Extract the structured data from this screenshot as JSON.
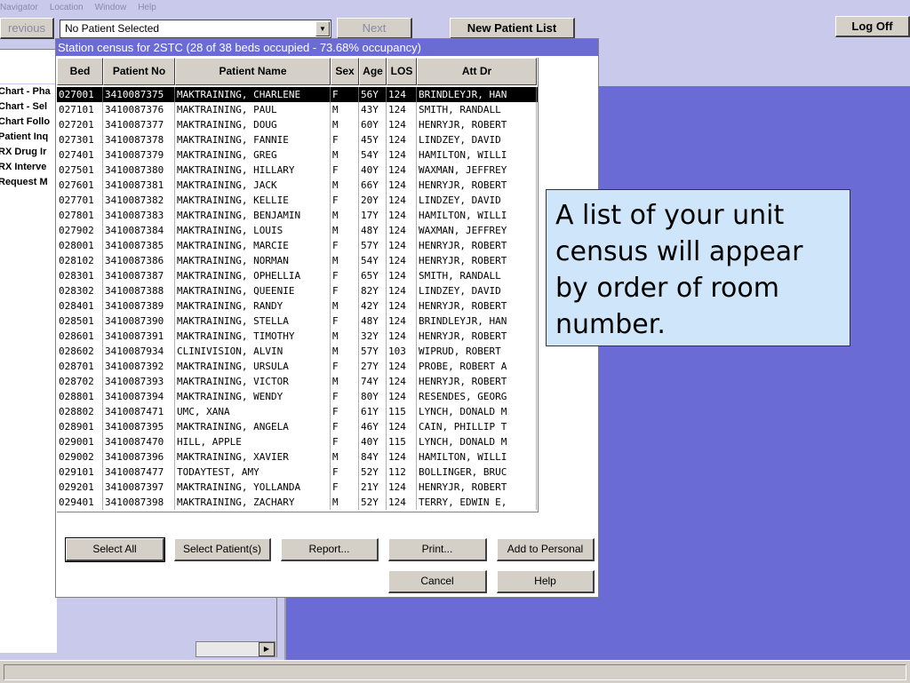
{
  "menubar": {
    "items": [
      "Navigator",
      "Location",
      "Window",
      "Help"
    ]
  },
  "toolbar": {
    "previous_label": "revious",
    "patient_select_value": "No Patient Selected",
    "next_label": "Next",
    "new_patient_list_label": "New Patient List",
    "log_off_label": "Log Off"
  },
  "left_panel": {
    "items": [
      "Chart - Pha",
      "Chart - Sel",
      "Chart Follo",
      "Patient Inq",
      "RX Drug Ir",
      "RX Interve",
      "Request M"
    ]
  },
  "dialog": {
    "title": "Station census for 2STC (28 of 38 beds occupied - 73.68% occupancy)",
    "columns": [
      "Bed",
      "Patient No",
      "Patient Name",
      "Sex",
      "Age",
      "LOS",
      "Att Dr"
    ],
    "rows": [
      [
        "027001",
        "3410087375",
        "MAKTRAINING, CHARLENE",
        "F",
        "56Y",
        "124",
        "BRINDLEYJR, HAN"
      ],
      [
        "027101",
        "3410087376",
        "MAKTRAINING, PAUL",
        "M",
        "43Y",
        "124",
        "SMITH, RANDALL"
      ],
      [
        "027201",
        "3410087377",
        "MAKTRAINING, DOUG",
        "M",
        "60Y",
        "124",
        "HENRYJR, ROBERT"
      ],
      [
        "027301",
        "3410087378",
        "MAKTRAINING, FANNIE",
        "F",
        "45Y",
        "124",
        "LINDZEY, DAVID"
      ],
      [
        "027401",
        "3410087379",
        "MAKTRAINING, GREG",
        "M",
        "54Y",
        "124",
        "HAMILTON, WILLI"
      ],
      [
        "027501",
        "3410087380",
        "MAKTRAINING, HILLARY",
        "F",
        "40Y",
        "124",
        "WAXMAN, JEFFREY"
      ],
      [
        "027601",
        "3410087381",
        "MAKTRAINING, JACK",
        "M",
        "66Y",
        "124",
        "HENRYJR, ROBERT"
      ],
      [
        "027701",
        "3410087382",
        "MAKTRAINING, KELLIE",
        "F",
        "20Y",
        "124",
        "LINDZEY, DAVID"
      ],
      [
        "027801",
        "3410087383",
        "MAKTRAINING, BENJAMIN",
        "M",
        "17Y",
        "124",
        "HAMILTON, WILLI"
      ],
      [
        "027902",
        "3410087384",
        "MAKTRAINING, LOUIS",
        "M",
        "48Y",
        "124",
        "WAXMAN, JEFFREY"
      ],
      [
        "028001",
        "3410087385",
        "MAKTRAINING, MARCIE",
        "F",
        "57Y",
        "124",
        "HENRYJR, ROBERT"
      ],
      [
        "028102",
        "3410087386",
        "MAKTRAINING, NORMAN",
        "M",
        "54Y",
        "124",
        "HENRYJR, ROBERT"
      ],
      [
        "028301",
        "3410087387",
        "MAKTRAINING, OPHELLIA",
        "F",
        "65Y",
        "124",
        "SMITH, RANDALL"
      ],
      [
        "028302",
        "3410087388",
        "MAKTRAINING, QUEENIE",
        "F",
        "82Y",
        "124",
        "LINDZEY, DAVID"
      ],
      [
        "028401",
        "3410087389",
        "MAKTRAINING, RANDY",
        "M",
        "42Y",
        "124",
        "HENRYJR, ROBERT"
      ],
      [
        "028501",
        "3410087390",
        "MAKTRAINING, STELLA",
        "F",
        "48Y",
        "124",
        "BRINDLEYJR, HAN"
      ],
      [
        "028601",
        "3410087391",
        "MAKTRAINING, TIMOTHY",
        "M",
        "32Y",
        "124",
        "HENRYJR, ROBERT"
      ],
      [
        "028602",
        "3410087934",
        "CLINIVISION, ALVIN",
        "M",
        "57Y",
        "103",
        "WIPRUD, ROBERT"
      ],
      [
        "028701",
        "3410087392",
        "MAKTRAINING, URSULA",
        "F",
        "27Y",
        "124",
        "PROBE, ROBERT A"
      ],
      [
        "028702",
        "3410087393",
        "MAKTRAINING, VICTOR",
        "M",
        "74Y",
        "124",
        "HENRYJR, ROBERT"
      ],
      [
        "028801",
        "3410087394",
        "MAKTRAINING, WENDY",
        "F",
        "80Y",
        "124",
        "RESENDES, GEORG"
      ],
      [
        "028802",
        "3410087471",
        "UMC, XANA",
        "F",
        "61Y",
        "115",
        "LYNCH, DONALD M"
      ],
      [
        "028901",
        "3410087395",
        "MAKTRAINING, ANGELA",
        "F",
        "46Y",
        "124",
        "CAIN, PHILLIP T"
      ],
      [
        "029001",
        "3410087470",
        "HILL, APPLE",
        "F",
        "40Y",
        "115",
        "LYNCH, DONALD M"
      ],
      [
        "029002",
        "3410087396",
        "MAKTRAINING, XAVIER",
        "M",
        "84Y",
        "124",
        "HAMILTON, WILLI"
      ],
      [
        "029101",
        "3410087477",
        "TODAYTEST, AMY",
        "F",
        "52Y",
        "112",
        "BOLLINGER, BRUC"
      ],
      [
        "029201",
        "3410087397",
        "MAKTRAINING, YOLLANDA",
        "F",
        "21Y",
        "124",
        "HENRYJR, ROBERT"
      ],
      [
        "029401",
        "3410087398",
        "MAKTRAINING, ZACHARY",
        "M",
        "52Y",
        "124",
        "TERRY, EDWIN E,"
      ]
    ],
    "buttons": {
      "select_all": "Select All",
      "select_patients": "Select Patient(s)",
      "report": "Report...",
      "print": "Print...",
      "add_to_personal": "Add to Personal",
      "cancel": "Cancel",
      "help": "Help"
    }
  },
  "callout": {
    "text": "A list of your unit census will appear by order of room number."
  },
  "colors": {
    "title_bar": "#6b6bd6",
    "background_area": "#6b6bd6",
    "callout_bg": "#cfe6fa",
    "window_bg": "#c9c9ec"
  }
}
